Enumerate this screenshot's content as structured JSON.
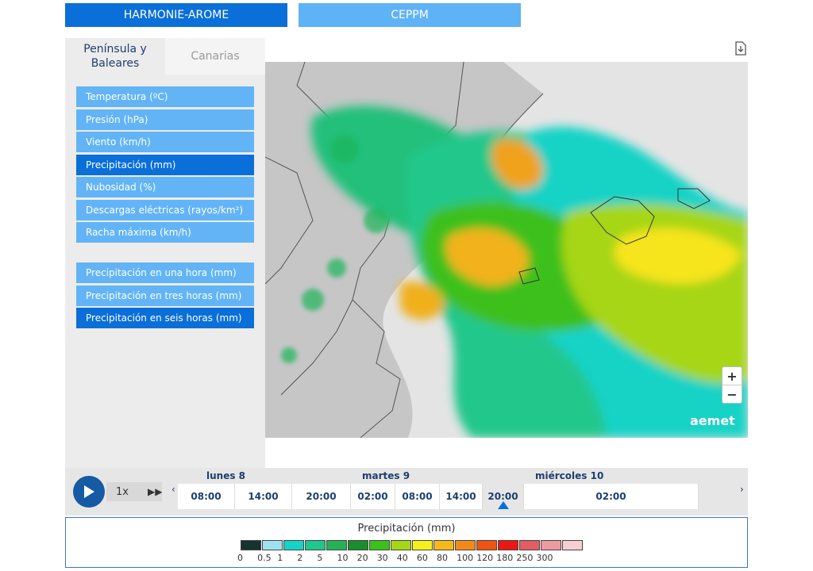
{
  "models": {
    "harmonie": "HARMONIE-AROME",
    "ceppm": "CEPPM"
  },
  "regions": {
    "peninsula": "Península y Baleares",
    "canarias": "Canarias"
  },
  "menu_primary": [
    "Temperatura (ºC)",
    "Presión (hPa)",
    "Viento (km/h)",
    "Precipitación (mm)",
    "Nubosidad (%)",
    "Descargas eléctricas (rayos/km²)",
    "Racha máxima (km/h)"
  ],
  "menu_secondary": [
    "Precipitación en una hora (mm)",
    "Precipitación en tres horas (mm)",
    "Precipitación en seis horas (mm)"
  ],
  "map": {
    "brand": "aemet",
    "zoom_in": "+",
    "zoom_out": "−",
    "download_icon": "download-icon"
  },
  "player": {
    "speed": "1x",
    "play_icon": "play-icon",
    "forward_icon": "fast-forward-icon"
  },
  "timeline": {
    "days": [
      "lunes 8",
      "martes 9",
      "miércoles 10"
    ],
    "hours": [
      "08:00",
      "14:00",
      "20:00",
      "02:00",
      "08:00",
      "14:00",
      "20:00",
      "02:00"
    ],
    "selected_hour_index": 6,
    "prev": "‹",
    "next": "›"
  },
  "legend": {
    "title": "Precipitación (mm)",
    "colors": [
      "#16332f",
      "#9ee2f2",
      "#17d3c6",
      "#20c78c",
      "#25b156",
      "#1a8d2d",
      "#3cc01c",
      "#a6d617",
      "#f6f11a",
      "#f6b91a",
      "#f28a1a",
      "#ef5414",
      "#ea1712",
      "#e25d64",
      "#ee9aa1",
      "#f7cfd3"
    ],
    "labels": [
      "0",
      "0.5",
      "1",
      "2",
      "5",
      "10",
      "20",
      "30",
      "40",
      "60",
      "80",
      "100",
      "120",
      "180",
      "250",
      "300"
    ]
  }
}
